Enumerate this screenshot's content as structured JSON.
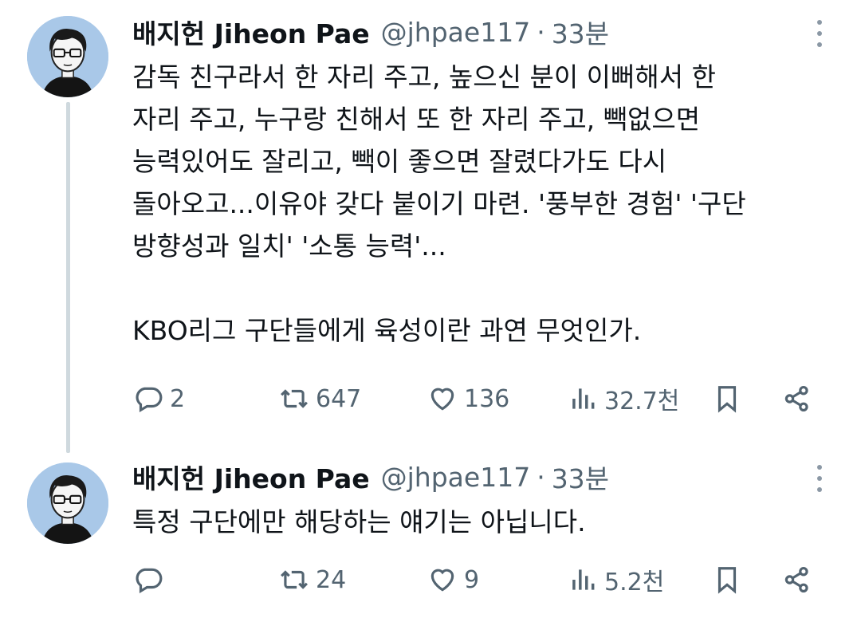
{
  "thread": [
    {
      "author": {
        "name": "배지헌 Jiheon Pae",
        "handle": "@jhpae117",
        "separator": "·",
        "time": "33분"
      },
      "body": "감독 친구라서 한 자리 주고, 높으신 분이 이뻐해서 한\n자리 주고, 누구랑 친해서 또 한 자리 주고, 빽없으면\n능력있어도 잘리고, 빽이 좋으면 잘렸다가도 다시\n돌아오고...이유야 갖다 붙이기 마련. '풍부한 경험' '구단\n방향성과 일치' '소통 능력'...\n\nKBO리그 구단들에게 육성이란 과연 무엇인가.",
      "actions": {
        "replies": "2",
        "retweets": "647",
        "likes": "136",
        "views": "32.7천"
      }
    },
    {
      "author": {
        "name": "배지헌 Jiheon Pae",
        "handle": "@jhpae117",
        "separator": "·",
        "time": "33분"
      },
      "body": "특정 구단에만 해당하는 얘기는 아닙니다.",
      "actions": {
        "replies": "",
        "retweets": "24",
        "likes": "9",
        "views": "5.2천"
      }
    }
  ],
  "icons": {
    "reply": "reply-icon",
    "retweet": "retweet-icon",
    "like": "heart-icon",
    "views": "views-icon",
    "bookmark": "bookmark-icon",
    "share": "share-icon",
    "more": "more-dots-icon"
  },
  "colors": {
    "text": "#0f1419",
    "secondary": "#536471",
    "thread_line": "#cfd9de",
    "avatar_bg": "#a9c8e8"
  }
}
